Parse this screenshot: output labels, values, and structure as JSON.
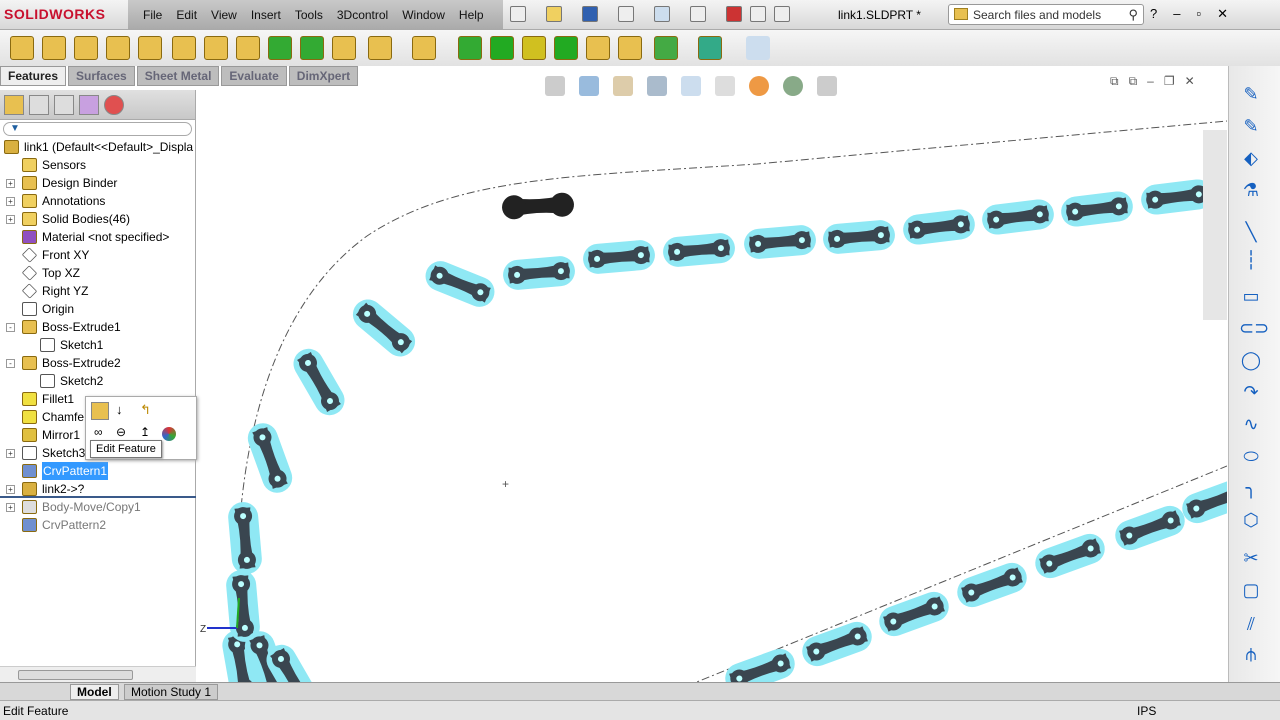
{
  "app": {
    "logo": "SOLIDWORKS",
    "document_title": "link1.SLDPRT *"
  },
  "menu": [
    "File",
    "Edit",
    "View",
    "Insert",
    "Tools",
    "3Dcontrol",
    "Window",
    "Help"
  ],
  "search": {
    "placeholder": "Search files and models"
  },
  "tabs": [
    "Features",
    "Surfaces",
    "Sheet Metal",
    "Evaluate",
    "DimXpert"
  ],
  "tree": {
    "filter_icon": "funnel-icon",
    "nodes": [
      {
        "label": "link1  (Default<<Default>_Displa",
        "level": 0,
        "expander": "",
        "icon": "part"
      },
      {
        "label": "Sensors",
        "level": 1,
        "expander": "",
        "icon": "sensor"
      },
      {
        "label": "Design Binder",
        "level": 1,
        "expander": "+",
        "icon": "binder"
      },
      {
        "label": "Annotations",
        "level": 1,
        "expander": "+",
        "icon": "annotation"
      },
      {
        "label": "Solid Bodies(46)",
        "level": 1,
        "expander": "+",
        "icon": "folder"
      },
      {
        "label": "Material <not specified>",
        "level": 1,
        "expander": "",
        "icon": "material"
      },
      {
        "label": "Front XY",
        "level": 1,
        "expander": "",
        "icon": "plane"
      },
      {
        "label": "Top XZ",
        "level": 1,
        "expander": "",
        "icon": "plane"
      },
      {
        "label": "Right YZ",
        "level": 1,
        "expander": "",
        "icon": "plane"
      },
      {
        "label": "Origin",
        "level": 1,
        "expander": "",
        "icon": "origin"
      },
      {
        "label": "Boss-Extrude1",
        "level": 1,
        "expander": "-",
        "icon": "extrude"
      },
      {
        "label": "Sketch1",
        "level": 2,
        "expander": "",
        "icon": "sketch"
      },
      {
        "label": "Boss-Extrude2",
        "level": 1,
        "expander": "-",
        "icon": "extrude"
      },
      {
        "label": "Sketch2",
        "level": 2,
        "expander": "",
        "icon": "sketch"
      },
      {
        "label": "Fillet1",
        "level": 1,
        "expander": "",
        "icon": "fillet"
      },
      {
        "label": "Chamfe",
        "level": 1,
        "expander": "",
        "icon": "fillet"
      },
      {
        "label": "Mirror1",
        "level": 1,
        "expander": "",
        "icon": "mirror"
      },
      {
        "label": "Sketch3",
        "level": 1,
        "expander": "+",
        "icon": "sketch"
      },
      {
        "label": "CrvPattern1",
        "level": 1,
        "expander": "",
        "icon": "pattern",
        "selected": true
      },
      {
        "label": "link2->?",
        "level": 1,
        "expander": "+",
        "icon": "part"
      },
      {
        "label": "Body-Move/Copy1",
        "level": 1,
        "expander": "+",
        "icon": "move",
        "suppressed": true
      },
      {
        "label": "CrvPattern2",
        "level": 1,
        "expander": "",
        "icon": "pattern",
        "suppressed": true
      }
    ]
  },
  "tooltip": "Edit Feature",
  "bottom_tabs": [
    "Model",
    "Motion Study 1"
  ],
  "status": {
    "message": "Edit Feature",
    "units": "IPS"
  },
  "colors": {
    "highlight": "#8fe8f4",
    "link": "#3a4650",
    "selected_tree": "#3399ff"
  }
}
